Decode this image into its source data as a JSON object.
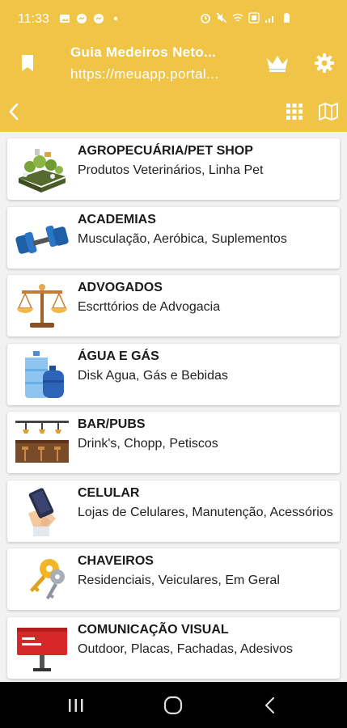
{
  "status_bar": {
    "time": "11:33",
    "left_icons": [
      "gallery-icon",
      "messenger-icon",
      "messenger-icon",
      "dot-icon"
    ],
    "right_icons": [
      "alarm-icon",
      "mute-icon",
      "wifi-icon",
      "volte-icon",
      "signal-icon",
      "battery-icon"
    ]
  },
  "app_bar": {
    "title": "Guia Medeiros Neto...",
    "url": "https://meuapp.portal...",
    "icons": [
      "bookmark-icon",
      "crown-icon",
      "gear-icon"
    ]
  },
  "toolbar": {
    "icons": [
      "back-arrow-icon",
      "grid-icon",
      "map-icon"
    ]
  },
  "categories": [
    {
      "title": "AGROPECUÁRIA/PET SHOP",
      "description": "Produtos Veterinários, Linha Pet",
      "icon": "farm-icon"
    },
    {
      "title": "ACADEMIAS",
      "description": "Musculação, Aeróbica, Suplementos",
      "icon": "dumbbell-icon"
    },
    {
      "title": "ADVOGADOS",
      "description": "Escrttórios de Advogacia",
      "icon": "scales-icon"
    },
    {
      "title": "ÁGUA E GÁS",
      "description": "Disk Agua, Gás e Bebidas",
      "icon": "water-gas-icon"
    },
    {
      "title": "BAR/PUBS",
      "description": "Drink's, Chopp, Petiscos",
      "icon": "bar-icon"
    },
    {
      "title": "CELULAR",
      "description": "Lojas de Celulares, Manutenção, Acessórios",
      "icon": "phone-icon"
    },
    {
      "title": "CHAVEIROS",
      "description": "Residenciais, Veiculares, Em Geral",
      "icon": "keys-icon"
    },
    {
      "title": "COMUNICAÇÃO VISUAL",
      "description": "Outdoor, Placas, Fachadas, Adesivos",
      "icon": "billboard-icon"
    }
  ],
  "nav_bar": {
    "icons": [
      "recent-apps-icon",
      "home-icon",
      "back-icon"
    ]
  },
  "colors": {
    "accent": "#f0c447",
    "background": "#f2f2f2",
    "card": "#ffffff",
    "nav_bar": "#000000"
  }
}
